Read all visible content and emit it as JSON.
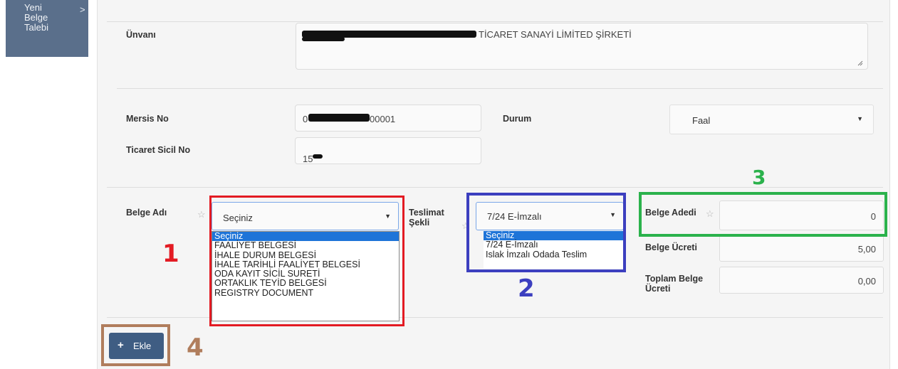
{
  "sidebar": {
    "label": "Yeni\nBelge\nTalebi",
    "chevron": ">"
  },
  "form": {
    "unvan_label": "Ünvanı",
    "unvan_value": "TİCARET SANAYİ LİMİTED ŞİRKETİ",
    "mersis_label": "Mersis No",
    "mersis_value_start": "0",
    "mersis_value_end": "00001",
    "durum_label": "Durum",
    "durum_value": "Faal",
    "sicil_label": "Ticaret Sicil No",
    "sicil_value": "15",
    "belge_adi_label": "Belge Adı",
    "belge_adi_value": "Seçiniz",
    "belge_adi_options": [
      "Seçiniz",
      "FAALİYET BELGESİ",
      "İHALE DURUM BELGESİ",
      "İHALE TARİHLİ FAALİYET BELGESİ",
      "ODA KAYIT SİCİL SURETİ",
      "ORTAKLIK TEYİD BELGESİ",
      "REGISTRY DOCUMENT"
    ],
    "teslimat_label": "Teslimat Şekli",
    "teslimat_value": "7/24 E-İmzalı",
    "teslimat_options": [
      "Seçiniz",
      "7/24 E-İmzalı",
      "Islak İmzalı Odada Teslim"
    ],
    "adet_label": "Belge Adedi",
    "adet_value": "0",
    "ucret_label": "Belge Ücreti",
    "ucret_value": "5,00",
    "toplam_label": "Toplam Belge Ücreti",
    "toplam_value": "0,00",
    "add_button": "Ekle"
  },
  "annotations": {
    "n1": "1",
    "n2": "2",
    "n3": "3",
    "n4": "4",
    "color1": "#e31b23",
    "color2": "#3c3fbf",
    "color3": "#2bb24c",
    "color4": "#b07d5c"
  },
  "icons": {
    "star": "star-icon",
    "plus": "plus-icon",
    "arrow": "chevron-down-icon"
  }
}
